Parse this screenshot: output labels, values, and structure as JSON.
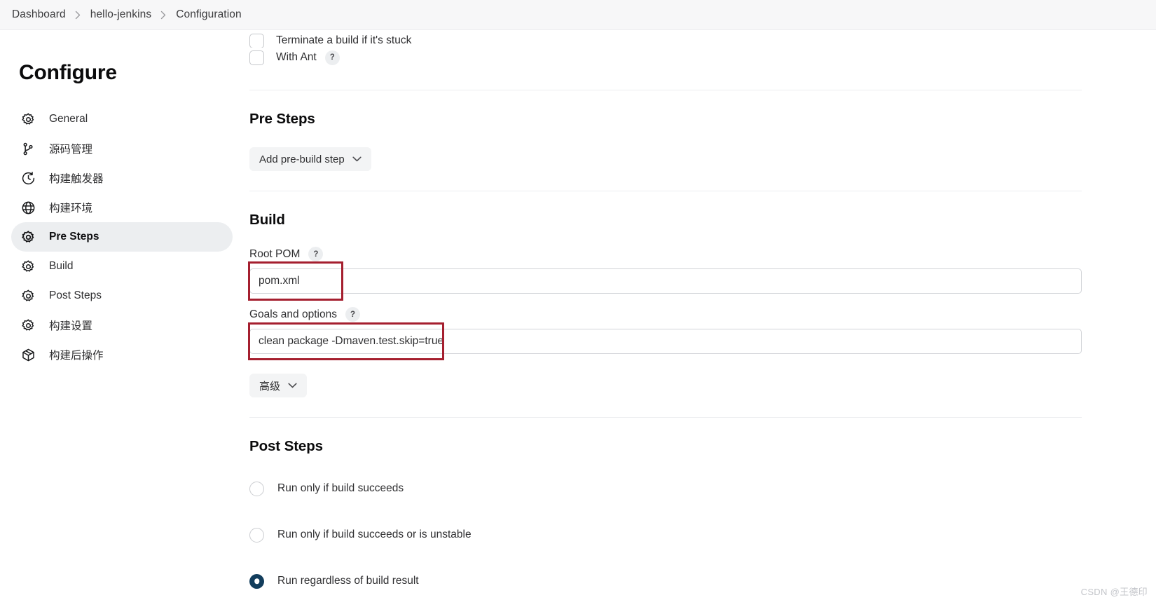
{
  "breadcrumb": {
    "items": [
      "Dashboard",
      "hello-jenkins",
      "Configuration"
    ]
  },
  "sidebar": {
    "title": "Configure",
    "items": [
      {
        "label": "General",
        "icon": "gear-icon",
        "active": false
      },
      {
        "label": "源码管理",
        "icon": "branch-icon",
        "active": false
      },
      {
        "label": "构建触发器",
        "icon": "clock-icon",
        "active": false
      },
      {
        "label": "构建环境",
        "icon": "globe-icon",
        "active": false
      },
      {
        "label": "Pre Steps",
        "icon": "gear-icon",
        "active": true
      },
      {
        "label": "Build",
        "icon": "gear-icon",
        "active": false
      },
      {
        "label": "Post Steps",
        "icon": "gear-icon",
        "active": false
      },
      {
        "label": "构建设置",
        "icon": "gear-icon",
        "active": false
      },
      {
        "label": "构建后操作",
        "icon": "package-icon",
        "active": false
      }
    ]
  },
  "main": {
    "clipped_checkbox_label": "Terminate a build if it's stuck",
    "with_ant": {
      "label": "With Ant",
      "help": "?",
      "checked": false
    },
    "pre_steps": {
      "title": "Pre Steps",
      "add_button_label": "Add pre-build step"
    },
    "build": {
      "title": "Build",
      "root_pom": {
        "label": "Root POM",
        "help": "?",
        "value": "pom.xml",
        "placeholder": ""
      },
      "goals": {
        "label": "Goals and options",
        "help": "?",
        "value": "clean package -Dmaven.test.skip=true",
        "placeholder": ""
      },
      "advanced_button_label": "高级"
    },
    "post_steps": {
      "title": "Post Steps",
      "options": [
        {
          "label": "Run only if build succeeds",
          "selected": false
        },
        {
          "label": "Run only if build succeeds or is unstable",
          "selected": false
        },
        {
          "label": "Run regardless of build result",
          "selected": true
        }
      ]
    }
  },
  "watermark": "CSDN @王德印",
  "colors": {
    "annotation_red": "#a51f2f",
    "radio_selected": "#123d5c",
    "sidebar_active_bg": "#eceef0",
    "breadcrumb_bg": "#f7f7f8"
  }
}
